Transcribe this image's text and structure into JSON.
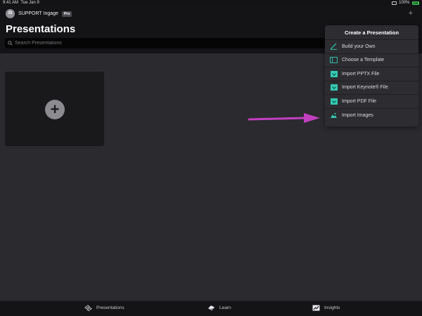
{
  "status_bar": {
    "time": "9:41 AM",
    "date": "Tue Jan 9",
    "battery_percent": "100%",
    "battery_badge": "CH"
  },
  "header": {
    "avatar_initials": "SI",
    "user_name": "SUPPORT Ingage",
    "badge": "Pro",
    "add_button": "+",
    "title": "Presentations"
  },
  "search": {
    "placeholder": "Search Presentations",
    "value": ""
  },
  "add_tile": {
    "symbol": "+"
  },
  "create_menu": {
    "title": "Create a Presentation",
    "items": [
      {
        "label": "Build your Own",
        "icon": "pen-icon"
      },
      {
        "label": "Choose a Template",
        "icon": "template-icon"
      },
      {
        "label": "Import PPTX File",
        "icon": "file-import-icon"
      },
      {
        "label": "Import Keynote® File",
        "icon": "file-import-icon"
      },
      {
        "label": "Import PDF File",
        "icon": "file-import-icon"
      },
      {
        "label": "Import Images",
        "icon": "image-icon"
      }
    ]
  },
  "annotation": {
    "color": "#c33fc0"
  },
  "tab_bar": {
    "tabs": [
      {
        "label": "Presentations",
        "icon": "presentations-icon"
      },
      {
        "label": "Learn",
        "icon": "learn-icon"
      },
      {
        "label": "Insights",
        "icon": "insights-icon"
      }
    ]
  },
  "colors": {
    "accent_teal": "#34c9b1",
    "background": "#2a2a2f",
    "header": "#141417"
  }
}
